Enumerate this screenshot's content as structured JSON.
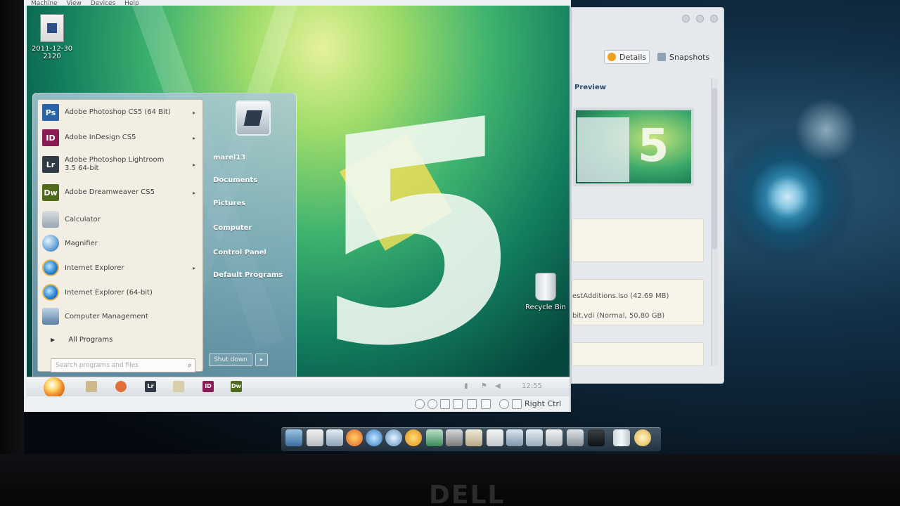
{
  "vm": {
    "menubar": [
      "Machine",
      "View",
      "Devices",
      "Help"
    ]
  },
  "desktop": {
    "file_icon_label_line1": "2011-12-30",
    "file_icon_label_line2": "2120",
    "recycle_bin_label": "Recycle Bin"
  },
  "start_menu": {
    "programs": [
      {
        "label": "Adobe Photoshop CS5 (64 Bit)",
        "abbr": "Ps",
        "color": "#2a63a8",
        "has_submenu": true
      },
      {
        "label": "Adobe InDesign CS5",
        "abbr": "ID",
        "color": "#8a1b54",
        "has_submenu": true
      },
      {
        "label": "Adobe Photoshop Lightroom 3.5 64-bit",
        "abbr": "Lr",
        "color": "#2f3a44",
        "has_submenu": true
      },
      {
        "label": "Adobe Dreamweaver CS5",
        "abbr": "Dw",
        "color": "#4f6b1e",
        "has_submenu": true
      },
      {
        "label": "Calculator",
        "icon": "calculator-icon",
        "has_submenu": false
      },
      {
        "label": "Magnifier",
        "icon": "magnifier-icon",
        "has_submenu": false
      },
      {
        "label": "Internet Explorer",
        "icon": "internet-explorer-icon",
        "has_submenu": true
      },
      {
        "label": "Internet Explorer (64-bit)",
        "icon": "internet-explorer-icon",
        "has_submenu": false
      },
      {
        "label": "Computer Management",
        "icon": "computer-management-icon",
        "has_submenu": false
      }
    ],
    "all_programs": "All Programs",
    "search_placeholder": "Search programs and files",
    "right": {
      "user": "marel13",
      "documents": "Documents",
      "pictures": "Pictures",
      "computer": "Computer",
      "control_panel": "Control Panel",
      "default_programs": "Default Programs"
    },
    "shutdown_label": "Shut down"
  },
  "taskbar": {
    "clock": "12:55"
  },
  "vm_status": {
    "host_key": "Right Ctrl"
  },
  "side_panel": {
    "tabs": {
      "details": "Details",
      "snapshots": "Snapshots"
    },
    "preview_heading": "Preview",
    "storage_line1": "estAdditions.iso (42.69 MB)",
    "storage_line2": "bit.vdi (Normal, 50.80 GB)"
  },
  "bezel": {
    "brand": "DELL"
  }
}
